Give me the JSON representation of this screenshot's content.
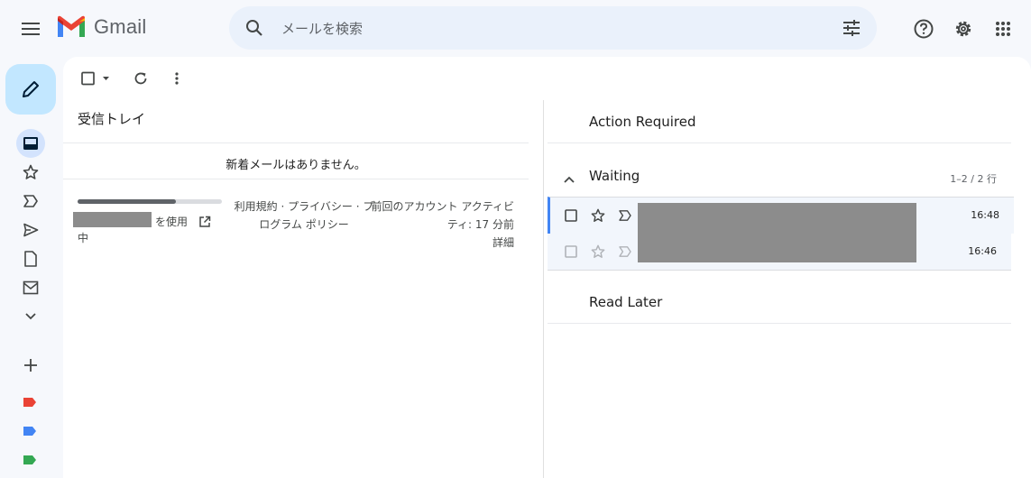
{
  "header": {
    "app_name": "Gmail",
    "search_placeholder": "メールを検索"
  },
  "toolbar": {},
  "left_pane": {
    "title": "受信トレイ",
    "empty_message": "新着メールはありません。",
    "storage_fraction": 0.68,
    "storage_suffix": "を使用",
    "storage_suffix_2": "中",
    "terms_line1": "利用規約 · プライバシー · プ",
    "terms_line2": "ログラム ポリシー",
    "activity_line1": "前回のアカウント アクティビ",
    "activity_line2": "ティ: 17 分前",
    "activity_details": "詳細"
  },
  "right_pane": {
    "section_action_required": "Action Required",
    "section_waiting": "Waiting",
    "waiting_count": "1–2 / 2 行",
    "section_read_later": "Read Later",
    "rows": [
      {
        "time": "16:48"
      },
      {
        "time": "16:46"
      }
    ]
  },
  "colors": {
    "accent": "#0b57d0",
    "compose_bg": "#c2e7ff",
    "label_red": "#ea4335",
    "label_blue": "#4285f4",
    "label_green": "#34a853"
  }
}
